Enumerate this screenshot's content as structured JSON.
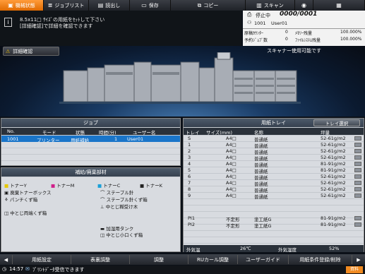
{
  "tabs": [
    {
      "label": "機械状態",
      "icon": "machine-icon"
    },
    {
      "label": "ジョブリスト",
      "icon": "joblist-icon"
    },
    {
      "label": "読出し",
      "icon": "recall-icon"
    },
    {
      "label": "保存",
      "icon": "save-icon"
    },
    {
      "label": "コピー",
      "icon": "copy-icon"
    },
    {
      "label": "スキャン",
      "icon": "scan-icon"
    }
  ],
  "message": {
    "line1": "8.5x11□ ｻｲｽﾞの用紙をｾｯﾄして下さい",
    "line2": "[詳細確認]で詳細を確認できます"
  },
  "status": {
    "state": "停止中",
    "counter": "0000/0001",
    "user_id": "1001",
    "user_name": "User01",
    "rows": [
      {
        "label": "原稿ｶｳﾝﾀｰ",
        "value": "0",
        "label2": "ﾒﾓﾘｰ残量",
        "value2": "100.000%"
      },
      {
        "label": "予約ｼﾞｮﾌﾞ数",
        "value": "0",
        "label2": "ﾌｧｲﾙｼｽﾃﾑ残量",
        "value2": "100.000%"
      }
    ],
    "scanner_msg": "スキャナー使用可能です"
  },
  "detail_button": "詳細確認",
  "job_panel": {
    "title": "ジョブ",
    "headers": [
      "No.",
      "モード",
      "状態",
      "時間(分)",
      "ユーザー名"
    ],
    "rows": [
      {
        "no": "1001",
        "mode": "プリンター",
        "state": "用紙補給",
        "time": "1",
        "user": "User01"
      }
    ]
  },
  "supply_panel": {
    "title": "補給/廃棄部材",
    "items": [
      {
        "label": "トナーY",
        "color": "#e6c800"
      },
      {
        "label": "トナーM",
        "color": "#d0208a"
      },
      {
        "label": "トナーC",
        "color": "#1aa0d8"
      },
      {
        "label": "トナーK",
        "color": "#222222"
      },
      {
        "label": "廃棄トナーボックス"
      },
      {
        "label": "ステープル針"
      },
      {
        "label": "パンチくず箱"
      },
      {
        "label": "ステープル針くず箱"
      },
      {
        "label": "中とじ糊受け木"
      },
      {
        "label": "中とじ両端くず箱"
      },
      {
        "label": "加湿用タンク"
      },
      {
        "label": "中とじ小口くず箱"
      }
    ]
  },
  "tray_panel": {
    "title": "用紙トレイ",
    "select_button": "トレイ選択",
    "headers": [
      "トレイ",
      "サイズ(mm)",
      "名称",
      "坪量"
    ],
    "rows": [
      {
        "tray": "S",
        "size": "A4□",
        "name": "普通紙",
        "weight": "52-61g/m2"
      },
      {
        "tray": "1",
        "size": "A4□",
        "name": "普通紙",
        "weight": "52-61g/m2"
      },
      {
        "tray": "2",
        "size": "A4□",
        "name": "普通紙",
        "weight": "52-61g/m2"
      },
      {
        "tray": "3",
        "size": "A4□",
        "name": "普通紙",
        "weight": "52-61g/m2"
      },
      {
        "tray": "4",
        "size": "A4□",
        "name": "普通紙",
        "weight": "81-91g/m2"
      },
      {
        "tray": "5",
        "size": "A4□",
        "name": "普通紙",
        "weight": "81-91g/m2"
      },
      {
        "tray": "6",
        "size": "A4□",
        "name": "普通紙",
        "weight": "52-61g/m2"
      },
      {
        "tray": "7",
        "size": "A4□",
        "name": "普通紙",
        "weight": "52-61g/m2"
      },
      {
        "tray": "8",
        "size": "A4□",
        "name": "普通紙",
        "weight": "52-61g/m2"
      },
      {
        "tray": "9",
        "size": "A4□",
        "name": "普通紙",
        "weight": "52-61g/m2"
      },
      {
        "tray": "PI1",
        "size": "不定形",
        "name": "塗工紙G",
        "weight": "81-91g/m2"
      },
      {
        "tray": "PI2",
        "size": "不定形",
        "name": "塗工紙G",
        "weight": "81-91g/m2"
      }
    ],
    "temp_label": "外気温",
    "temp_value": "26℃",
    "humidity_label": "外気湿度",
    "humidity_value": "52%"
  },
  "bottom_buttons": [
    "用紙設定",
    "表裏調整",
    "調整",
    "RUカール調整",
    "ユーザーガイド",
    "用紙条件登録/削除"
  ],
  "footer": {
    "time": "14:57",
    "message": "ﾌﾟﾘﾝﾄﾃﾞｰﾀ受信できます",
    "badge": "資料"
  },
  "accent": "#f08a20"
}
